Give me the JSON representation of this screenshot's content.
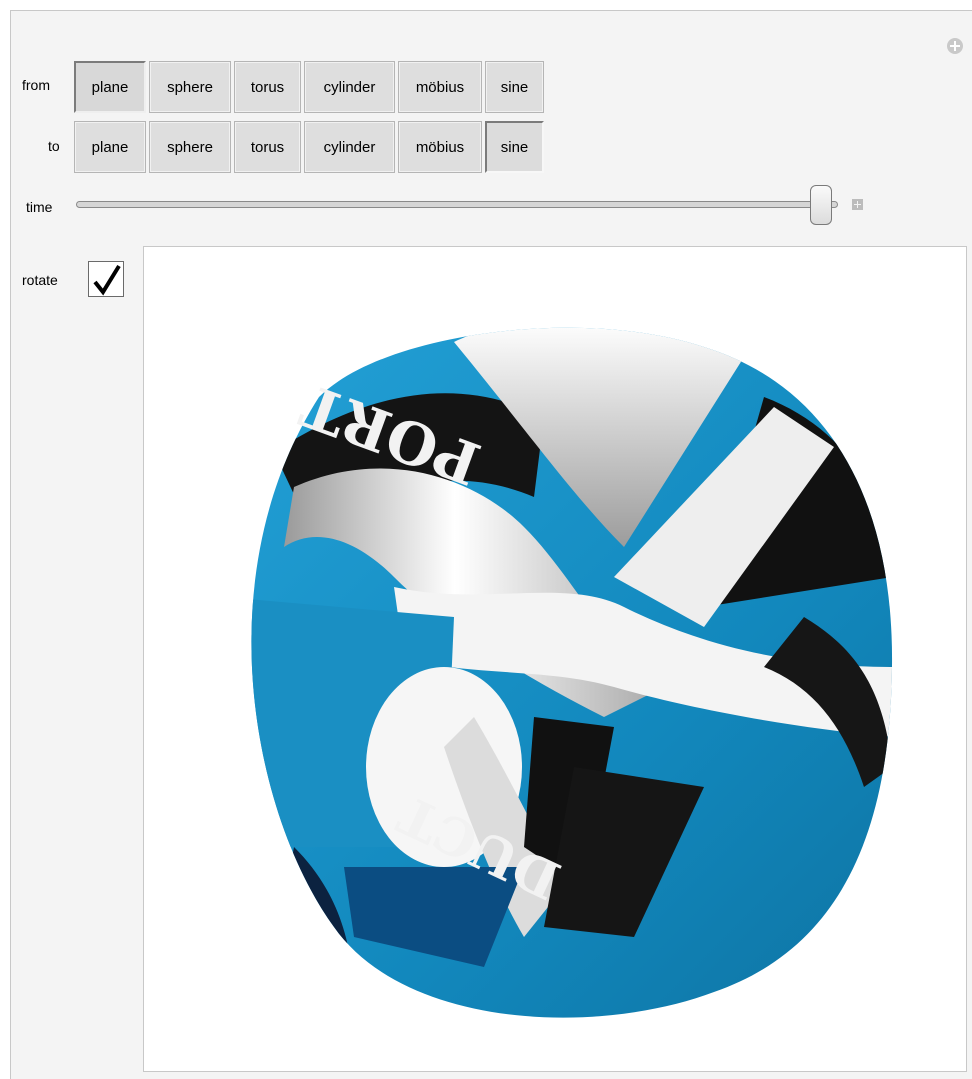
{
  "controls": {
    "from_label": "from",
    "to_label": "to",
    "time_label": "time",
    "rotate_label": "rotate",
    "rotate_checked": true,
    "from_options": [
      "plane",
      "sphere",
      "torus",
      "cylinder",
      "möbius",
      "sine"
    ],
    "from_selected": "plane",
    "to_options": [
      "plane",
      "sphere",
      "torus",
      "cylinder",
      "möbius",
      "sine"
    ],
    "to_selected": "sine",
    "time_value": 0.97
  },
  "graphic": {
    "texture_text_top": "PORT",
    "texture_text_bottom": "DUCT",
    "colors": {
      "blue": "#1390c4",
      "dark": "#151515",
      "white": "#f6f6f6"
    }
  }
}
